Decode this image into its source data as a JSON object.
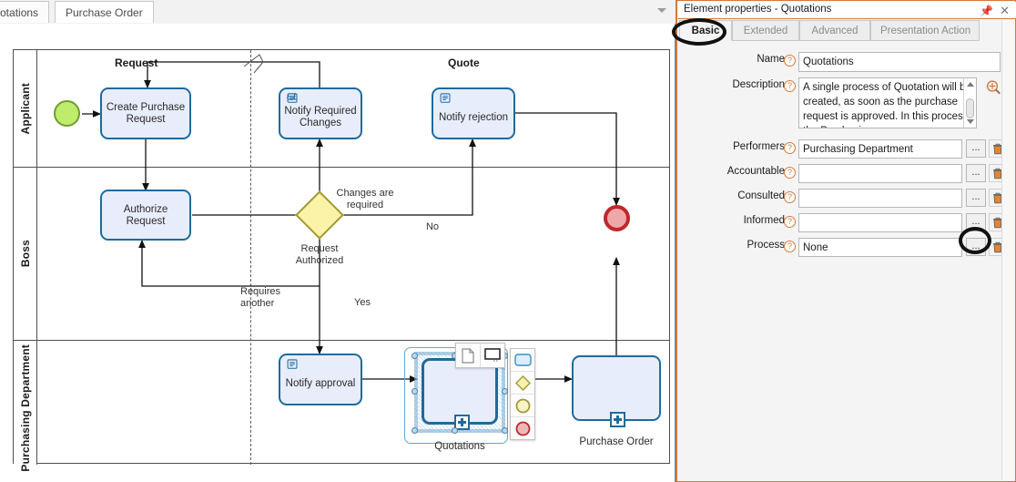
{
  "editor": {
    "tabs": [
      {
        "label": "Quotations",
        "active": false
      },
      {
        "label": "Purchase Order",
        "active": true
      }
    ],
    "tab_overflow_icon": "chevron-down-icon"
  },
  "diagram": {
    "lanes": [
      {
        "label": "Applicant"
      },
      {
        "label": "Boss"
      },
      {
        "label": "Purchasing Department"
      }
    ],
    "phases": [
      {
        "label": "Request"
      },
      {
        "label": "Quote"
      }
    ],
    "nodes": [
      {
        "id": "start",
        "type": "start-event",
        "label": ""
      },
      {
        "id": "create-purchase-request",
        "type": "task",
        "label": "Create Purchase\nRequest",
        "line1": "Create Purchase",
        "line2": "Request"
      },
      {
        "id": "notify-required-changes",
        "type": "script-task",
        "label": "Notify Required\nChanges",
        "line1": "Notify Required",
        "line2": "Changes"
      },
      {
        "id": "notify-rejection",
        "type": "script-task",
        "label": "Notify rejection",
        "line1": "Notify rejection",
        "line2": ""
      },
      {
        "id": "authorize-request",
        "type": "task",
        "label": "Authorize\nRequest",
        "line1": "Authorize",
        "line2": "Request"
      },
      {
        "id": "request-authorized",
        "type": "gateway",
        "label": "Request\nAuthorized",
        "line1": "Request",
        "line2": "Authorized"
      },
      {
        "id": "end",
        "type": "end-event",
        "label": ""
      },
      {
        "id": "notify-approval",
        "type": "script-task",
        "label": "Notify approval",
        "line1": "Notify approval",
        "line2": ""
      },
      {
        "id": "quotations",
        "type": "subprocess",
        "label": "Quotations",
        "selected": true
      },
      {
        "id": "purchase-order",
        "type": "subprocess",
        "label": "Purchase Order",
        "selected": false
      }
    ],
    "flow_labels": [
      {
        "id": "changes-are-required",
        "line1": "Changes are",
        "line2": "required"
      },
      {
        "id": "no",
        "line1": "No",
        "line2": ""
      },
      {
        "id": "yes",
        "line1": "Yes",
        "line2": ""
      },
      {
        "id": "requires-another",
        "line1": "Requires",
        "line2": "another"
      }
    ],
    "palette_top": [
      {
        "icon": "data-object-icon"
      },
      {
        "icon": "text-annotation-icon"
      }
    ],
    "palette_right": [
      {
        "icon": "task-shape-icon"
      },
      {
        "icon": "gateway-shape-icon"
      },
      {
        "icon": "intermediate-event-shape-icon"
      },
      {
        "icon": "end-event-shape-icon"
      }
    ]
  },
  "panel": {
    "title": "Element properties - Quotations",
    "pin_icon": "pin-icon",
    "close_icon": "close-icon",
    "tabs": [
      {
        "label": "Basic",
        "active": true
      },
      {
        "label": "Extended",
        "active": false
      },
      {
        "label": "Advanced",
        "active": false
      },
      {
        "label": "Presentation Action",
        "active": false
      }
    ],
    "tabs_overflow_icon": "chevron-down-icon",
    "fields": [
      {
        "id": "name",
        "label": "Name",
        "value": "Quotations",
        "help_icon": "help-icon"
      },
      {
        "id": "description",
        "label": "Description",
        "value": "A single process of Quotation will be created, as soon as the purchase request is approved. In this process, the Purchasing",
        "help_icon": "help-icon",
        "zoom_icon": "magnifier-icon"
      },
      {
        "id": "performers",
        "label": "Performers",
        "value": "Purchasing Department",
        "help_icon": "help-icon"
      },
      {
        "id": "accountable",
        "label": "Accountable",
        "value": "",
        "help_icon": "help-icon"
      },
      {
        "id": "consulted",
        "label": "Consulted",
        "value": "",
        "help_icon": "help-icon"
      },
      {
        "id": "informed",
        "label": "Informed",
        "value": "",
        "help_icon": "help-icon"
      },
      {
        "id": "process",
        "label": "Process",
        "value": "None",
        "help_icon": "help-icon"
      }
    ],
    "browse_button_label": "...",
    "delete_icon": "trash-icon"
  },
  "annotations": [
    {
      "id": "basic-tab-highlight",
      "shape": "oval"
    },
    {
      "id": "process-browse-highlight",
      "shape": "oval"
    }
  ],
  "colors": {
    "accent_orange": "#d4793a",
    "task_fill": "#e8edfb",
    "task_stroke": "#1d6b9e",
    "start_fill": "#c0ec6d",
    "end_fill": "#efa8a8",
    "end_stroke": "#c1272d",
    "gateway_fill": "#fbf3a8"
  }
}
